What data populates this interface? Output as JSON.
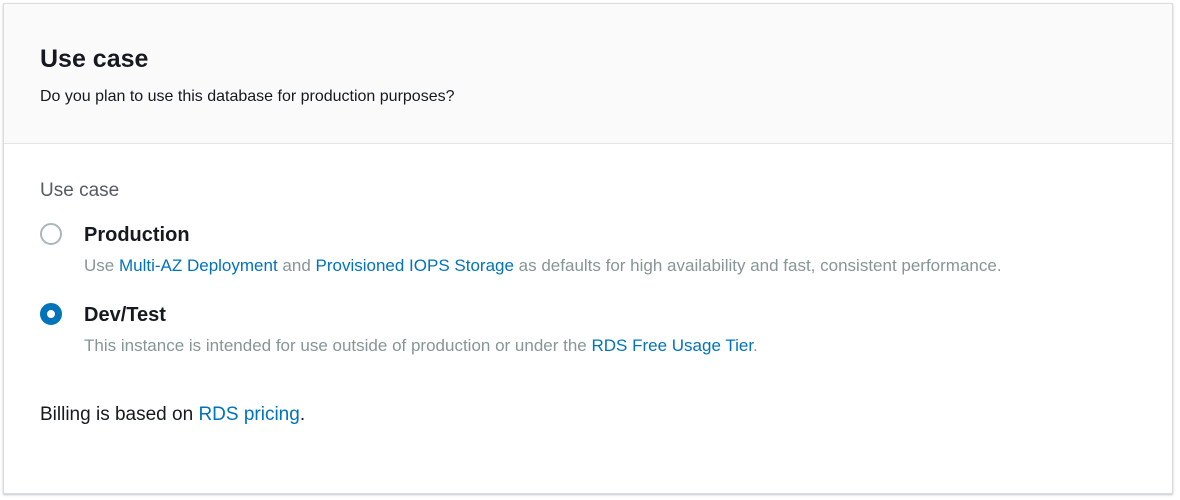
{
  "header": {
    "title": "Use case",
    "description": "Do you plan to use this database for production purposes?"
  },
  "body": {
    "field_label": "Use case",
    "options": [
      {
        "label": "Production",
        "selected": false,
        "desc_part1": "Use ",
        "link1": "Multi-AZ Deployment",
        "desc_part2": " and ",
        "link2": "Provisioned IOPS Storage",
        "desc_part3": " as defaults for high availability and fast, consistent performance."
      },
      {
        "label": "Dev/Test",
        "selected": true,
        "desc_part1": "This instance is intended for use outside of production or under the ",
        "link1": "RDS Free Usage Tier",
        "desc_part2": "."
      }
    ],
    "billing": {
      "prefix": "Billing is based on ",
      "link": "RDS pricing",
      "suffix": "."
    }
  },
  "colors": {
    "link": "#0073bb",
    "radio_selected": "#0073bb",
    "radio_unselected_border": "#aab7b8",
    "muted_text": "#879596",
    "header_bg": "#fafafa"
  }
}
